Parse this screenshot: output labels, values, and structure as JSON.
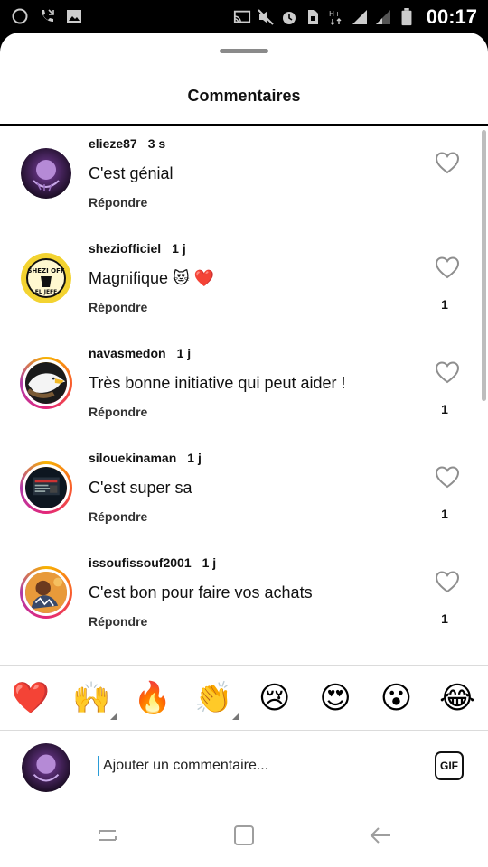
{
  "status_bar": {
    "time": "00:17"
  },
  "sheet": {
    "title": "Commentaires"
  },
  "comments": [
    {
      "username": "elieze87",
      "time": "3 s",
      "text": "C'est génial",
      "reply_label": "Répondre",
      "likes": ""
    },
    {
      "username": "sheziofficiel",
      "time": "1 j",
      "text": "Magnifique 😻 ❤️",
      "reply_label": "Répondre",
      "likes": "1"
    },
    {
      "username": "navasmedon",
      "time": "1 j",
      "text": "Très bonne initiative qui peut aider !",
      "reply_label": "Répondre",
      "likes": "1"
    },
    {
      "username": "silouekinaman",
      "time": "1 j",
      "text": "C'est super sa",
      "reply_label": "Répondre",
      "likes": "1"
    },
    {
      "username": "issoufissouf2001",
      "time": "1 j",
      "text": "C'est bon pour faire vos achats",
      "reply_label": "Répondre",
      "likes": "1"
    }
  ],
  "emoji_bar": [
    "❤️",
    "🙌",
    "🔥",
    "👏",
    "😢",
    "😍",
    "😮",
    "😂"
  ],
  "input": {
    "placeholder": "Ajouter un commentaire...",
    "gif_label": "GIF"
  }
}
